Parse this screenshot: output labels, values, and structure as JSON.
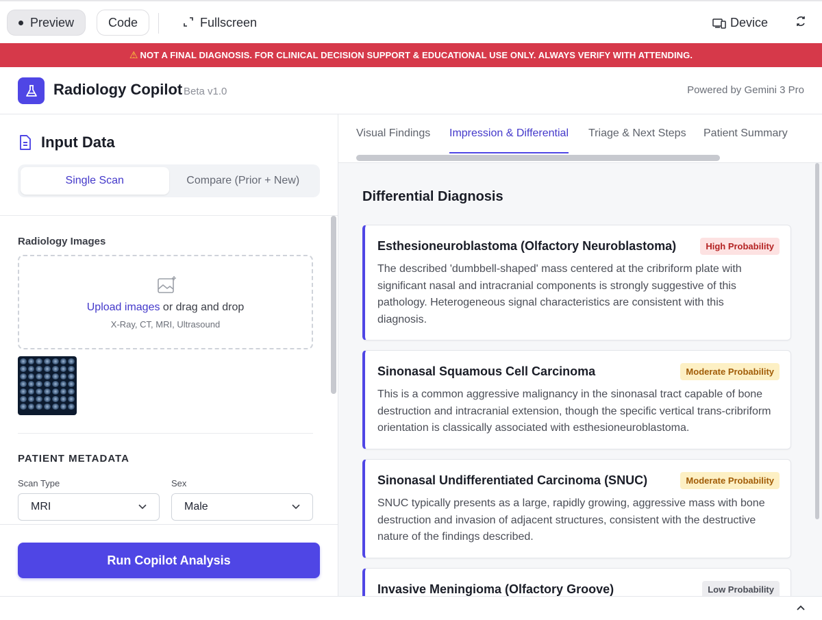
{
  "toolbar": {
    "preview": "Preview",
    "code": "Code",
    "fullscreen": "Fullscreen",
    "device": "Device"
  },
  "banner": {
    "text": "NOT A FINAL DIAGNOSIS. FOR CLINICAL DECISION SUPPORT & EDUCATIONAL USE ONLY. ALWAYS VERIFY WITH ATTENDING."
  },
  "header": {
    "title": "Radiology Copilot",
    "beta": "Beta v1.0",
    "powered_by": "Powered by Gemini 3 Pro"
  },
  "input": {
    "title": "Input Data",
    "modes": [
      "Single Scan",
      "Compare (Prior + New)"
    ],
    "active_mode": 0,
    "images_label": "Radiology Images",
    "upload_link": "Upload images",
    "upload_rest": " or drag and drop",
    "upload_sub": "X-Ray, CT, MRI, Ultrasound",
    "metadata_title": "PATIENT METADATA",
    "scan_type_label": "Scan Type",
    "scan_type_value": "MRI",
    "sex_label": "Sex",
    "sex_value": "Male",
    "run_button": "Run Copilot Analysis"
  },
  "tabs": [
    "Visual Findings",
    "Impression & Differential",
    "Triage & Next Steps",
    "Patient Summary"
  ],
  "active_tab": 1,
  "differential": {
    "title": "Differential Diagnosis",
    "items": [
      {
        "name": "Esthesioneuroblastoma (Olfactory Neuroblastoma)",
        "probability": "High Probability",
        "level": "high",
        "description": "The described 'dumbbell-shaped' mass centered at the cribriform plate with significant nasal and intracranial components is strongly suggestive of this pathology. Heterogeneous signal characteristics are consistent with this diagnosis."
      },
      {
        "name": "Sinonasal Squamous Cell Carcinoma",
        "probability": "Moderate Probability",
        "level": "moderate",
        "description": "This is a common aggressive malignancy in the sinonasal tract capable of bone destruction and intracranial extension, though the specific vertical trans-cribriform orientation is classically associated with esthesioneuroblastoma."
      },
      {
        "name": "Sinonasal Undifferentiated Carcinoma (SNUC)",
        "probability": "Moderate Probability",
        "level": "moderate",
        "description": "SNUC typically presents as a large, rapidly growing, aggressive mass with bone destruction and invasion of adjacent structures, consistent with the destructive nature of the findings described."
      },
      {
        "name": "Invasive Meningioma (Olfactory Groove)",
        "probability": "Low Probability",
        "level": "low",
        "description": ""
      }
    ]
  },
  "colors": {
    "accent": "#4f46e5",
    "banner": "#d6394a"
  }
}
